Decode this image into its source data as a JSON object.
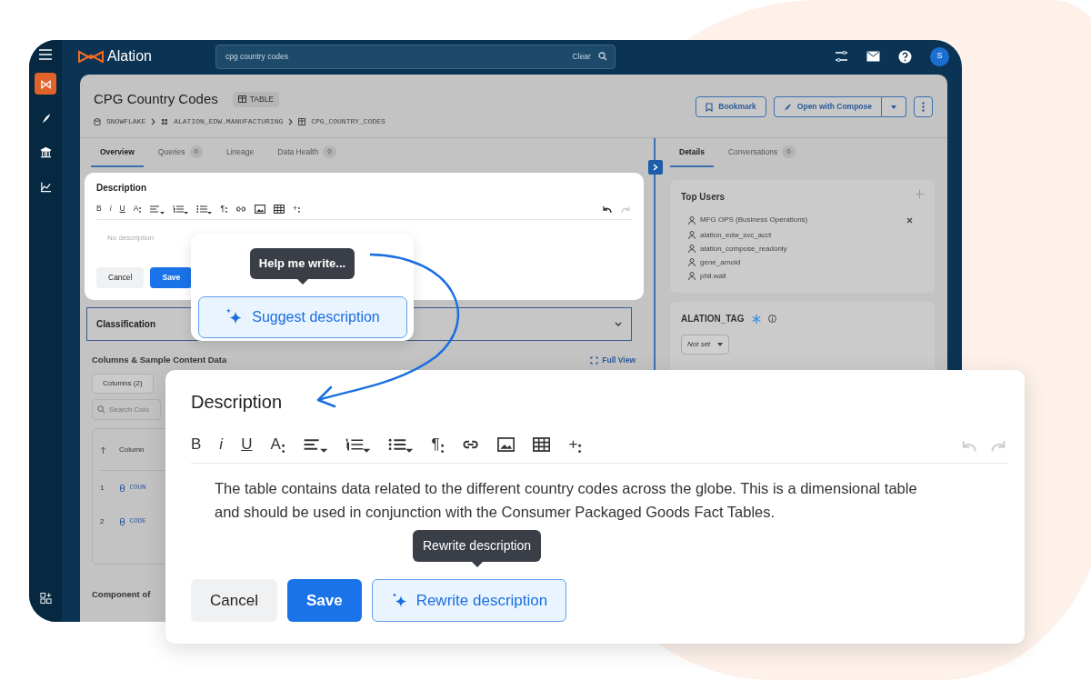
{
  "app": {
    "brand": "Alation",
    "search": {
      "value": "cpg country codes",
      "clear": "Clear"
    },
    "avatar": "S"
  },
  "rail": [
    {
      "kind": "logo",
      "selected": true
    },
    {
      "kind": "compose",
      "selected": false
    },
    {
      "kind": "catalog",
      "selected": false
    },
    {
      "kind": "analytics",
      "selected": false
    },
    {
      "kind": "apps",
      "selected": false
    }
  ],
  "page": {
    "title": "CPG Country Codes",
    "type_badge": "TABLE",
    "breadcrumb": [
      "SNOWFLAKE",
      "ALATION_EDW.MANUFACTURING",
      "CPG_COUNTRY_CODES"
    ],
    "bookmark": "Bookmark",
    "compose": "Open with Compose"
  },
  "tabs": [
    {
      "label": "Overview",
      "selected": true
    },
    {
      "label": "Queries",
      "count": "0",
      "selected": false
    },
    {
      "label": "Lineage",
      "selected": false
    },
    {
      "label": "Data Health",
      "count": "0",
      "selected": false
    }
  ],
  "inline_editor": {
    "title": "Description",
    "placeholder": "No description",
    "toolbar": [
      {
        "kind": "bold",
        "label": "B"
      },
      {
        "kind": "italic",
        "label": "i"
      },
      {
        "kind": "underline",
        "label": "U"
      },
      {
        "kind": "font-size",
        "label": "A"
      },
      {
        "kind": "align"
      },
      {
        "kind": "ordered-list"
      },
      {
        "kind": "bullet-list"
      },
      {
        "kind": "paragraph",
        "label": "¶"
      },
      {
        "kind": "link"
      },
      {
        "kind": "image"
      },
      {
        "kind": "table"
      },
      {
        "kind": "insert",
        "label": "+"
      }
    ],
    "history": [
      {
        "kind": "undo",
        "disabled": false
      },
      {
        "kind": "redo",
        "disabled": true
      }
    ],
    "buttons": [
      {
        "label": "Cancel",
        "kind": "secondary"
      },
      {
        "label": "Save",
        "kind": "primary"
      }
    ]
  },
  "classification": "Classification",
  "columns_section": {
    "title": "Columns & Sample Content Data",
    "full_view": "Full View",
    "columns_tab": "Columns (2)",
    "search_placeholder": "Search Colu",
    "header": "Column",
    "rows": [
      {
        "index": "1",
        "name": "COUN"
      },
      {
        "index": "2",
        "name": "CODE"
      }
    ],
    "component_of": "Component of"
  },
  "details_tabs": [
    {
      "label": "Details",
      "selected": true
    },
    {
      "label": "Conversations",
      "count": "0",
      "selected": false
    }
  ],
  "top_users": {
    "title": "Top Users",
    "users": [
      "MFG OPS (Business Operations)",
      "alation_edw_svc_acct",
      "alation_compose_readonly",
      "gene_arnold",
      "phil.wall"
    ]
  },
  "tag": {
    "title": "ALATION_TAG",
    "value": "Not set"
  },
  "suggest_popup": {
    "tooltip": "Help me write...",
    "button": {
      "label": "Suggest description",
      "kind": "ai"
    }
  },
  "description_card": {
    "title": "Description",
    "toolbar": [
      {
        "kind": "bold",
        "label": "B"
      },
      {
        "kind": "italic",
        "label": "i"
      },
      {
        "kind": "underline",
        "label": "U"
      },
      {
        "kind": "font-size",
        "label": "A"
      },
      {
        "kind": "align"
      },
      {
        "kind": "ordered-list"
      },
      {
        "kind": "bullet-list"
      },
      {
        "kind": "paragraph",
        "label": "¶"
      },
      {
        "kind": "link"
      },
      {
        "kind": "image"
      },
      {
        "kind": "table"
      },
      {
        "kind": "insert",
        "label": "+"
      }
    ],
    "history": [
      {
        "kind": "undo",
        "disabled": true
      },
      {
        "kind": "redo",
        "disabled": true
      }
    ],
    "text": "The table contains data related to the different country codes across the globe. This is a dimensional table and should be used in conjunction with the Consumer Packaged Goods Fact Tables.",
    "tooltip": "Rewrite description",
    "buttons": [
      {
        "label": "Cancel",
        "kind": "secondary"
      },
      {
        "label": "Save",
        "kind": "primary"
      },
      {
        "label": "Rewrite description",
        "kind": "ai"
      }
    ]
  }
}
